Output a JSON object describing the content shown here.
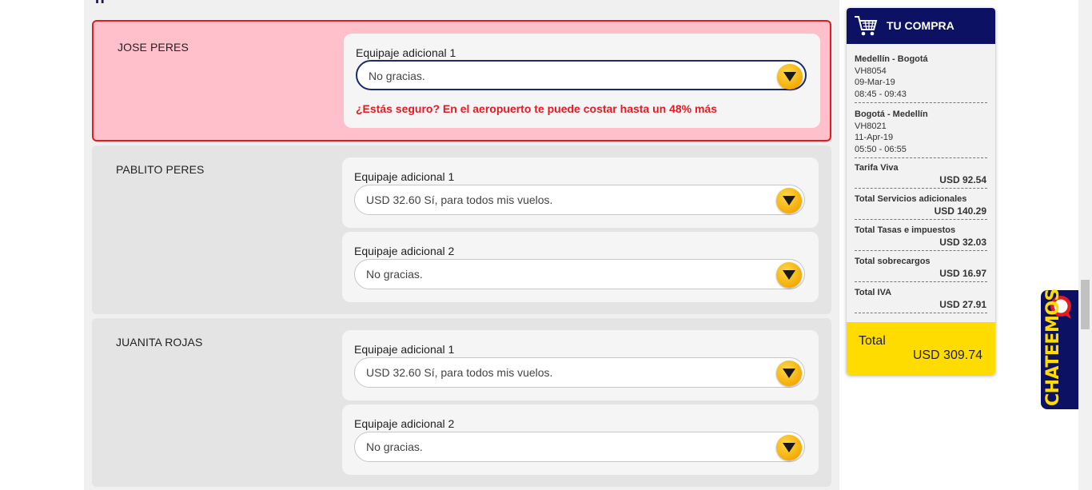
{
  "passengers": [
    {
      "name": "JOSE PERES",
      "state": "error",
      "bags": [
        {
          "label": "Equipaje adicional 1",
          "value": "No gracias.",
          "warning": "¿Estás seguro? En el aeropuerto te puede costar hasta un 48% más"
        }
      ]
    },
    {
      "name": "PABLITO PERES",
      "bags": [
        {
          "label": "Equipaje adicional 1",
          "value": "USD 32.60 Sí, para todos mis vuelos."
        },
        {
          "label": "Equipaje adicional 2",
          "value": "No gracias."
        }
      ]
    },
    {
      "name": "JUANITA ROJAS",
      "bags": [
        {
          "label": "Equipaje adicional 1",
          "value": "USD 32.60 Sí, para todos mis vuelos."
        },
        {
          "label": "Equipaje adicional 2",
          "value": "No gracias."
        }
      ]
    }
  ],
  "cart": {
    "title": "TU COMPRA",
    "icon": "shopping-cart-icon",
    "flights": [
      {
        "route": "Medellín - Bogotá",
        "code": "VH8054",
        "date": "09-Mar-19",
        "time": "08:45 - 09:43"
      },
      {
        "route": "Bogotá - Medellín",
        "code": "VH8021",
        "date": "11-Apr-19",
        "time": "05:50 - 06:55"
      }
    ],
    "lines": [
      {
        "label": "Tarifa Viva",
        "amount": "USD 92.54"
      },
      {
        "label": "Total Servicios adicionales",
        "amount": "USD 140.29"
      },
      {
        "label": "Total Tasas e impuestos",
        "amount": "USD 32.03"
      },
      {
        "label": "Total sobrecargos",
        "amount": "USD 16.97"
      },
      {
        "label": "Total IVA",
        "amount": "USD 27.91"
      }
    ],
    "total_label": "Total",
    "total_amount": "USD 309.74"
  },
  "chat": {
    "label": "CHATEEMOS",
    "icon": "chat-bubble-icon"
  },
  "colors": {
    "navy": "#0c1163",
    "yellow": "#ffdc00",
    "error_red": "#e31b23",
    "error_bg": "#ffc0cb"
  }
}
